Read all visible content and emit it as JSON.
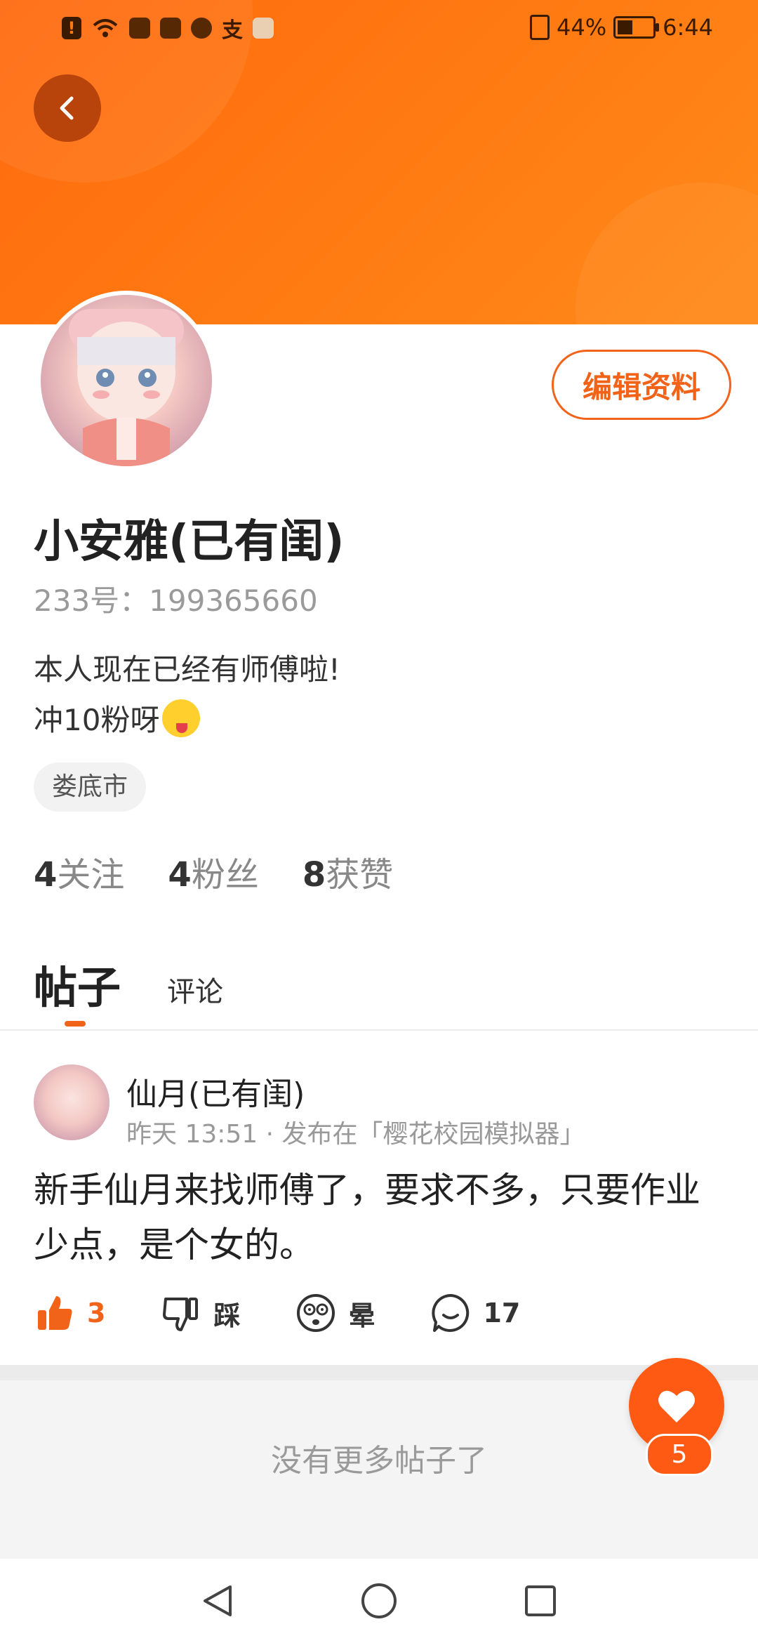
{
  "status_bar": {
    "battery_text": "44%",
    "battery_level": 0.44,
    "time": "6:44",
    "alipay_glyph": "支"
  },
  "header": {
    "back_icon": "chevron-left-icon",
    "accent_color": "#ff7a12"
  },
  "profile": {
    "name": "小安雅(已有闺)",
    "uid": "233号：199365660",
    "bio_line1": "本人现在已经有师傅啦!",
    "bio_line2": "冲10粉呀",
    "location": "娄底市",
    "edit_label": "编辑资料",
    "stats": [
      {
        "num": "4",
        "label": "关注"
      },
      {
        "num": "4",
        "label": "粉丝"
      },
      {
        "num": "8",
        "label": "获赞"
      }
    ]
  },
  "tabs": [
    {
      "label": "帖子",
      "active": true
    },
    {
      "label": "评论",
      "active": false
    }
  ],
  "post": {
    "author": "仙月(已有闺)",
    "meta": "昨天 13:51 · 发布在「樱花校园模拟器」",
    "body": "新手仙月来找师傅了，要求不多，只要作业少点，是个女的。",
    "actions": {
      "like_count": "3",
      "dislike_label": "踩",
      "dizzy_label": "晕",
      "comment_count": "17"
    }
  },
  "footer": {
    "no_more_text": "没有更多帖子了"
  },
  "fab": {
    "icon": "heart-icon",
    "count": "5"
  },
  "nav": {
    "back": "back-triangle-icon",
    "home": "home-circle-icon",
    "recents": "recents-square-icon"
  }
}
